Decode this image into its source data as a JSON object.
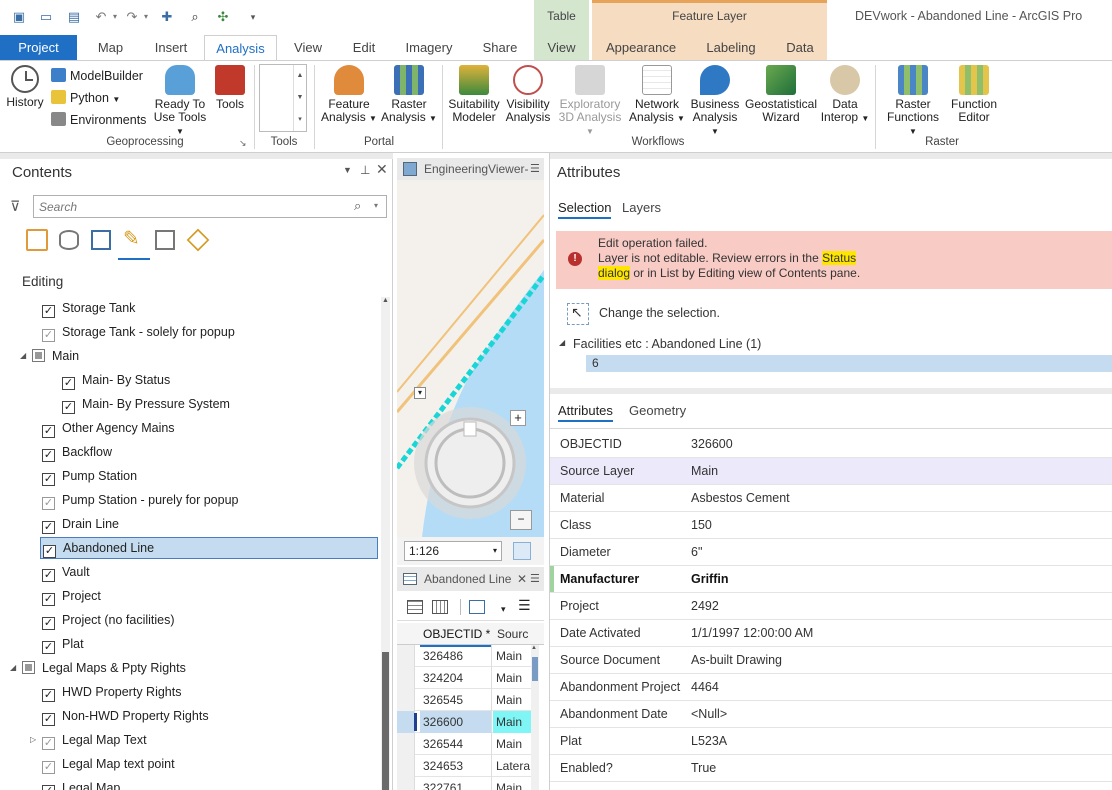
{
  "app": {
    "title": "DEVwork - Abandoned Line - ArcGIS Pro",
    "context_tabs": [
      {
        "group": "Table",
        "tab": "View"
      },
      {
        "group": "Feature Layer",
        "tabs": [
          "Appearance",
          "Labeling",
          "Data"
        ]
      }
    ]
  },
  "tabs": [
    "Project",
    "Map",
    "Insert",
    "Analysis",
    "View",
    "Edit",
    "Imagery",
    "Share"
  ],
  "context_tab_labels": {
    "table_group": "Table",
    "table_view": "View",
    "fl_group": "Feature Layer",
    "appearance": "Appearance",
    "labeling": "Labeling",
    "data": "Data"
  },
  "ribbon": {
    "history": "History",
    "modelbuilder": "ModelBuilder",
    "python": "Python",
    "environments": "Environments",
    "ready_to_use_1": "Ready To",
    "ready_to_use_2": "Use Tools",
    "tools": "Tools",
    "feature_analysis_1": "Feature",
    "feature_analysis_2": "Analysis",
    "raster_analysis_1": "Raster",
    "raster_analysis_2": "Analysis",
    "suitability_1": "Suitability",
    "suitability_2": "Modeler",
    "visibility_1": "Visibility",
    "visibility_2": "Analysis",
    "exploratory_1": "Exploratory",
    "exploratory_2": "3D Analysis",
    "network_1": "Network",
    "network_2": "Analysis",
    "business_1": "Business",
    "business_2": "Analysis",
    "geostat_1": "Geostatistical",
    "geostat_2": "Wizard",
    "datainterop_1": "Data",
    "datainterop_2": "Interop",
    "rasterfn_1": "Raster",
    "rasterfn_2": "Functions",
    "fneditor_1": "Function",
    "fneditor_2": "Editor",
    "groups": {
      "geoprocessing": "Geoprocessing",
      "tools": "Tools",
      "portal": "Portal",
      "workflows": "Workflows",
      "raster": "Raster"
    }
  },
  "contents": {
    "title": "Contents",
    "search_placeholder": "Search",
    "section": "Editing",
    "items": [
      {
        "label": "Storage Tank",
        "indent": 1,
        "check": "on"
      },
      {
        "label": "Storage Tank - solely for popup",
        "indent": 1,
        "check": "gray"
      },
      {
        "label": "Main",
        "indent": 0.5,
        "check": "part",
        "expand": "open"
      },
      {
        "label": "Main- By Status",
        "indent": 2,
        "check": "on"
      },
      {
        "label": "Main- By Pressure System",
        "indent": 2,
        "check": "on"
      },
      {
        "label": "Other Agency Mains",
        "indent": 1,
        "check": "on"
      },
      {
        "label": "Backflow",
        "indent": 1,
        "check": "on"
      },
      {
        "label": "Pump Station",
        "indent": 1,
        "check": "on"
      },
      {
        "label": "Pump Station - purely for popup",
        "indent": 1,
        "check": "gray"
      },
      {
        "label": "Drain Line",
        "indent": 1,
        "check": "on"
      },
      {
        "label": "Abandoned Line",
        "indent": 1,
        "check": "on",
        "selected": true
      },
      {
        "label": "Vault",
        "indent": 1,
        "check": "on"
      },
      {
        "label": "Project",
        "indent": 1,
        "check": "on"
      },
      {
        "label": "Project (no facilities)",
        "indent": 1,
        "check": "on"
      },
      {
        "label": "Plat",
        "indent": 1,
        "check": "on"
      },
      {
        "label": "Legal Maps & Ppty Rights",
        "indent": 0,
        "check": "part",
        "expand": "open"
      },
      {
        "label": "HWD Property Rights",
        "indent": 1,
        "check": "on"
      },
      {
        "label": "Non-HWD Property Rights",
        "indent": 1,
        "check": "on"
      },
      {
        "label": "Legal Map Text",
        "indent": 1,
        "check": "gray",
        "expand": "closed"
      },
      {
        "label": "Legal Map text point",
        "indent": 1,
        "check": "gray"
      },
      {
        "label": "Legal Map",
        "indent": 1,
        "check": "on"
      }
    ]
  },
  "map": {
    "tab_title": "EngineeringViewer-",
    "scale": "1:126"
  },
  "table": {
    "tab_title": "Abandoned Line",
    "columns": [
      "OBJECTID *",
      "Sourc"
    ],
    "rows": [
      {
        "id": "326486",
        "src": "Main"
      },
      {
        "id": "324204",
        "src": "Main"
      },
      {
        "id": "326545",
        "src": "Main"
      },
      {
        "id": "326600",
        "src": "Main",
        "selected": true
      },
      {
        "id": "326544",
        "src": "Main"
      },
      {
        "id": "324653",
        "src": "Latera"
      },
      {
        "id": "322761",
        "src": "Main"
      }
    ]
  },
  "attributes": {
    "title": "Attributes",
    "tabs": {
      "selection": "Selection",
      "layers": "Layers"
    },
    "error": {
      "line1": "Edit operation failed.",
      "line2_pre": "Layer is not editable. Review errors in the ",
      "hl1": "Status",
      "hl2": "dialog",
      "line3_post": " or in List by Editing view of Contents pane."
    },
    "change_selection": "Change the selection.",
    "tree_node": "Facilities etc : Abandoned Line (1)",
    "tree_value": "6",
    "lower_tabs": {
      "attributes": "Attributes",
      "geometry": "Geometry"
    },
    "fields": [
      {
        "key": "OBJECTID",
        "value": "326600"
      },
      {
        "key": "Source Layer",
        "value": "Main",
        "highlight": true
      },
      {
        "key": "Material",
        "value": "Asbestos Cement"
      },
      {
        "key": "Class",
        "value": "150"
      },
      {
        "key": "Diameter",
        "value": "6\""
      },
      {
        "key": "Manufacturer",
        "value": "Griffin",
        "bold": true
      },
      {
        "key": "Project",
        "value": "2492"
      },
      {
        "key": "Date Activated",
        "value": "1/1/1997 12:00:00 AM"
      },
      {
        "key": "Source Document",
        "value": "As-built Drawing"
      },
      {
        "key": "Abandonment Project",
        "value": "4464"
      },
      {
        "key": "Abandonment Date",
        "value": "<Null>"
      },
      {
        "key": "Plat",
        "value": "L523A"
      },
      {
        "key": "Enabled?",
        "value": "True"
      }
    ]
  }
}
